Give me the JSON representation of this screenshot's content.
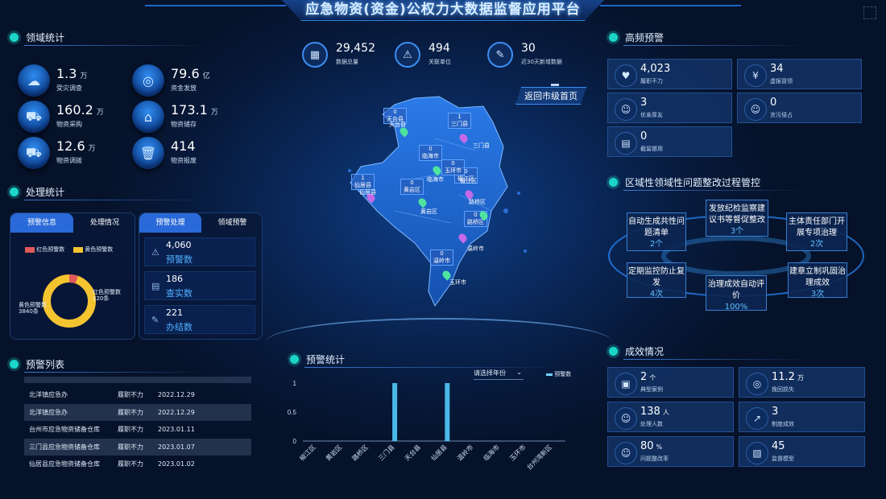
{
  "header": {
    "title": "应急物资(资金)公权力大数据监督应用平台",
    "fullscreen_icon": "expand-icon"
  },
  "domain_stats": {
    "title": "领域统计",
    "items": [
      {
        "value": "1.3",
        "unit": "万",
        "label": "受灾调查",
        "icon": "rain-cloud-icon"
      },
      {
        "value": "79.6",
        "unit": "亿",
        "label": "资金发放",
        "icon": "coin-stack-icon"
      },
      {
        "value": "160.2",
        "unit": "万",
        "label": "物资采购",
        "icon": "cart-icon"
      },
      {
        "value": "173.1",
        "unit": "万",
        "label": "物资储存",
        "icon": "warehouse-icon"
      },
      {
        "value": "12.6",
        "unit": "万",
        "label": "物资调拨",
        "icon": "truck-icon"
      },
      {
        "value": "414",
        "unit": "",
        "label": "物资报废",
        "icon": "trash-icon"
      }
    ]
  },
  "handling": {
    "title": "处理统计",
    "left_tabs": [
      "预警信息",
      "处理情况"
    ],
    "legend": [
      {
        "label": "红色预警数",
        "color": "#e05a5a"
      },
      {
        "label": "黄色预警数",
        "color": "#f4c430"
      }
    ],
    "donut": {
      "red_label": "红色预警数",
      "red_count": "220条",
      "yellow_label": "黄色预警数",
      "yellow_count": "3840条",
      "red": 220,
      "yellow": 3840
    },
    "right_tabs": [
      "预警处理",
      "领域预警"
    ],
    "rows": [
      {
        "value": "4,060",
        "label": "预警数",
        "icon": "warning-icon"
      },
      {
        "value": "186",
        "label": "查实数",
        "icon": "check-doc-icon"
      },
      {
        "value": "221",
        "label": "办结数",
        "icon": "done-doc-icon"
      }
    ]
  },
  "warning_list": {
    "title": "预警列表",
    "rows": [
      {
        "org": "北洋镇应急办",
        "type": "履职不力",
        "date": "2022.12.29"
      },
      {
        "org": "北洋镇应急办",
        "type": "履职不力",
        "date": "2022.12.29"
      },
      {
        "org": "台州市应急物资储备仓库",
        "type": "履职不力",
        "date": "2023.01.11"
      },
      {
        "org": "三门县应急物资储备仓库",
        "type": "履职不力",
        "date": "2023.01.07"
      },
      {
        "org": "仙居县应急物资储备仓库",
        "type": "履职不力",
        "date": "2023.01.02"
      }
    ]
  },
  "top_stats": [
    {
      "value": "29,452",
      "label": "数据总量",
      "icon": "database-icon"
    },
    {
      "value": "494",
      "label": "关联单位",
      "icon": "alert-triangle-icon"
    },
    {
      "value": "30",
      "label": "近30天新增数据",
      "icon": "edit-doc-icon"
    }
  ],
  "map": {
    "back_label": "返回市级首页",
    "regions": [
      {
        "count": "0",
        "name": "天台县"
      },
      {
        "count": "1",
        "name": "三门县"
      },
      {
        "count": "0",
        "name": "临海市"
      },
      {
        "count": "1",
        "name": "仙居县"
      },
      {
        "count": "0",
        "name": "黄岩区"
      },
      {
        "count": "0",
        "name": "椒江区"
      },
      {
        "count": "0",
        "name": "路桥区"
      },
      {
        "count": "0",
        "name": "温岭市"
      },
      {
        "count": "0",
        "name": "玉环市"
      }
    ],
    "towns": [
      "天台县",
      "三门县",
      "临海市",
      "仙居县",
      "黄岩区",
      "椒江区",
      "路桥区",
      "温岭市",
      "玉环市"
    ]
  },
  "chart_section": {
    "title": "预警统计",
    "select_placeholder": "请选择年份",
    "legend": "预警数"
  },
  "chart_data": {
    "type": "bar",
    "categories": [
      "椒江区",
      "黄岩区",
      "路桥区",
      "三门县",
      "天台县",
      "仙居县",
      "温岭市",
      "临海市",
      "玉环市",
      "台州湾新区"
    ],
    "series": [
      {
        "name": "预警数",
        "values": [
          0,
          0,
          0,
          1,
          0,
          1,
          0,
          0,
          0,
          0
        ]
      }
    ],
    "ylim": [
      0,
      1
    ],
    "yticks": [
      "0",
      "0.5",
      "1"
    ]
  },
  "high_freq": {
    "title": "高频预警",
    "cards": [
      {
        "value": "4,023",
        "label": "履职不力",
        "icon": "broken-heart-icon"
      },
      {
        "value": "34",
        "label": "虚报冒领",
        "icon": "money-bag-icon"
      },
      {
        "value": "3",
        "label": "优亲厚友",
        "icon": "users-icon"
      },
      {
        "value": "0",
        "label": "贪污侵占",
        "icon": "user-icon"
      },
      {
        "value": "0",
        "label": "截留挪用",
        "icon": "server-icon"
      }
    ]
  },
  "process": {
    "title": "区域性领域性问题整改过程管控",
    "steps": [
      {
        "text": "自动生成共性问题清单",
        "count": "2个"
      },
      {
        "text": "发放纪检监察建议书等督促整改",
        "count": "3个"
      },
      {
        "text": "主体责任部门开展专项治理",
        "count": "2次"
      },
      {
        "text": "建章立制巩固治理成效",
        "count": "3次"
      },
      {
        "text": "治理成效自动评价",
        "count": "100%"
      },
      {
        "text": "定期监控防止复发",
        "count": "4次"
      }
    ]
  },
  "results": {
    "title": "成效情况",
    "cards": [
      {
        "value": "2",
        "unit": "个",
        "label": "典型案例",
        "icon": "case-icon"
      },
      {
        "value": "11.2",
        "unit": "万",
        "label": "挽回损失",
        "icon": "coins-icon"
      },
      {
        "value": "138",
        "unit": "人",
        "label": "处理人数",
        "icon": "person-icon"
      },
      {
        "value": "3",
        "unit": "",
        "label": "制度成效",
        "icon": "chart-line-icon"
      },
      {
        "value": "80",
        "unit": "%",
        "label": "问题整改率",
        "icon": "team-icon"
      },
      {
        "value": "45",
        "unit": "",
        "label": "监督模型",
        "icon": "cube-icon"
      }
    ]
  }
}
